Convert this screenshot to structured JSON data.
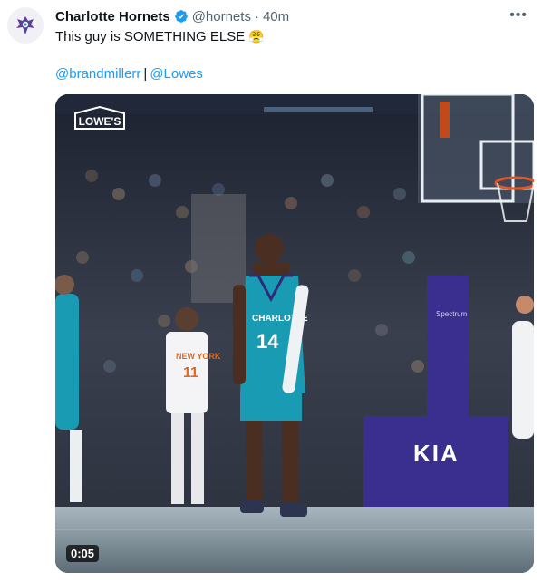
{
  "tweet": {
    "display_name": "Charlotte Hornets",
    "handle": "@hornets",
    "separator": "·",
    "time": "40m",
    "text": "This guy is SOMETHING ELSE",
    "emoji": "😤",
    "mentions": [
      "@brandmillerr",
      "@Lowes"
    ],
    "mention_separator": "|"
  },
  "video": {
    "duration": "0:05",
    "brand_overlay": "LOWE'S"
  },
  "icons": {
    "avatar": "hornet-logo-icon",
    "verified": "verified-badge-icon",
    "more": "more-options-icon"
  },
  "colors": {
    "link": "#1d9bf0",
    "verified": "#1d9bf0",
    "hornets_teal": "#1a9bb4",
    "hornets_purple": "#2e2a78",
    "kia_panel": "#3a2f8f",
    "court": "#7b8e99"
  }
}
